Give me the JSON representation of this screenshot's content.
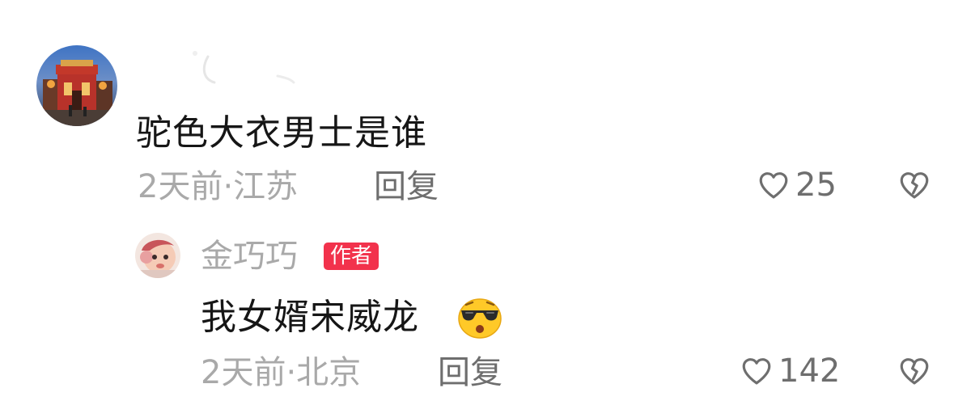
{
  "comments": [
    {
      "text": "驼色大衣男士是谁",
      "time": "2天前",
      "separator": "·",
      "location": "江苏",
      "reply_label": "回复",
      "likes": "25",
      "replies": [
        {
          "username": "金巧巧",
          "badge": "作者",
          "text": "我女婿宋威龙",
          "emoji": "sunglasses-face-emoji",
          "time": "2天前",
          "separator": "·",
          "location": "北京",
          "reply_label": "回复",
          "likes": "142"
        }
      ]
    }
  ],
  "icons": {
    "like": "heart-outline-icon",
    "dislike": "broken-heart-icon"
  },
  "colors": {
    "badge": "#f2324c",
    "primary_text": "#161616",
    "secondary_text": "#a9a9a9",
    "action_text": "#6e6e6e"
  }
}
